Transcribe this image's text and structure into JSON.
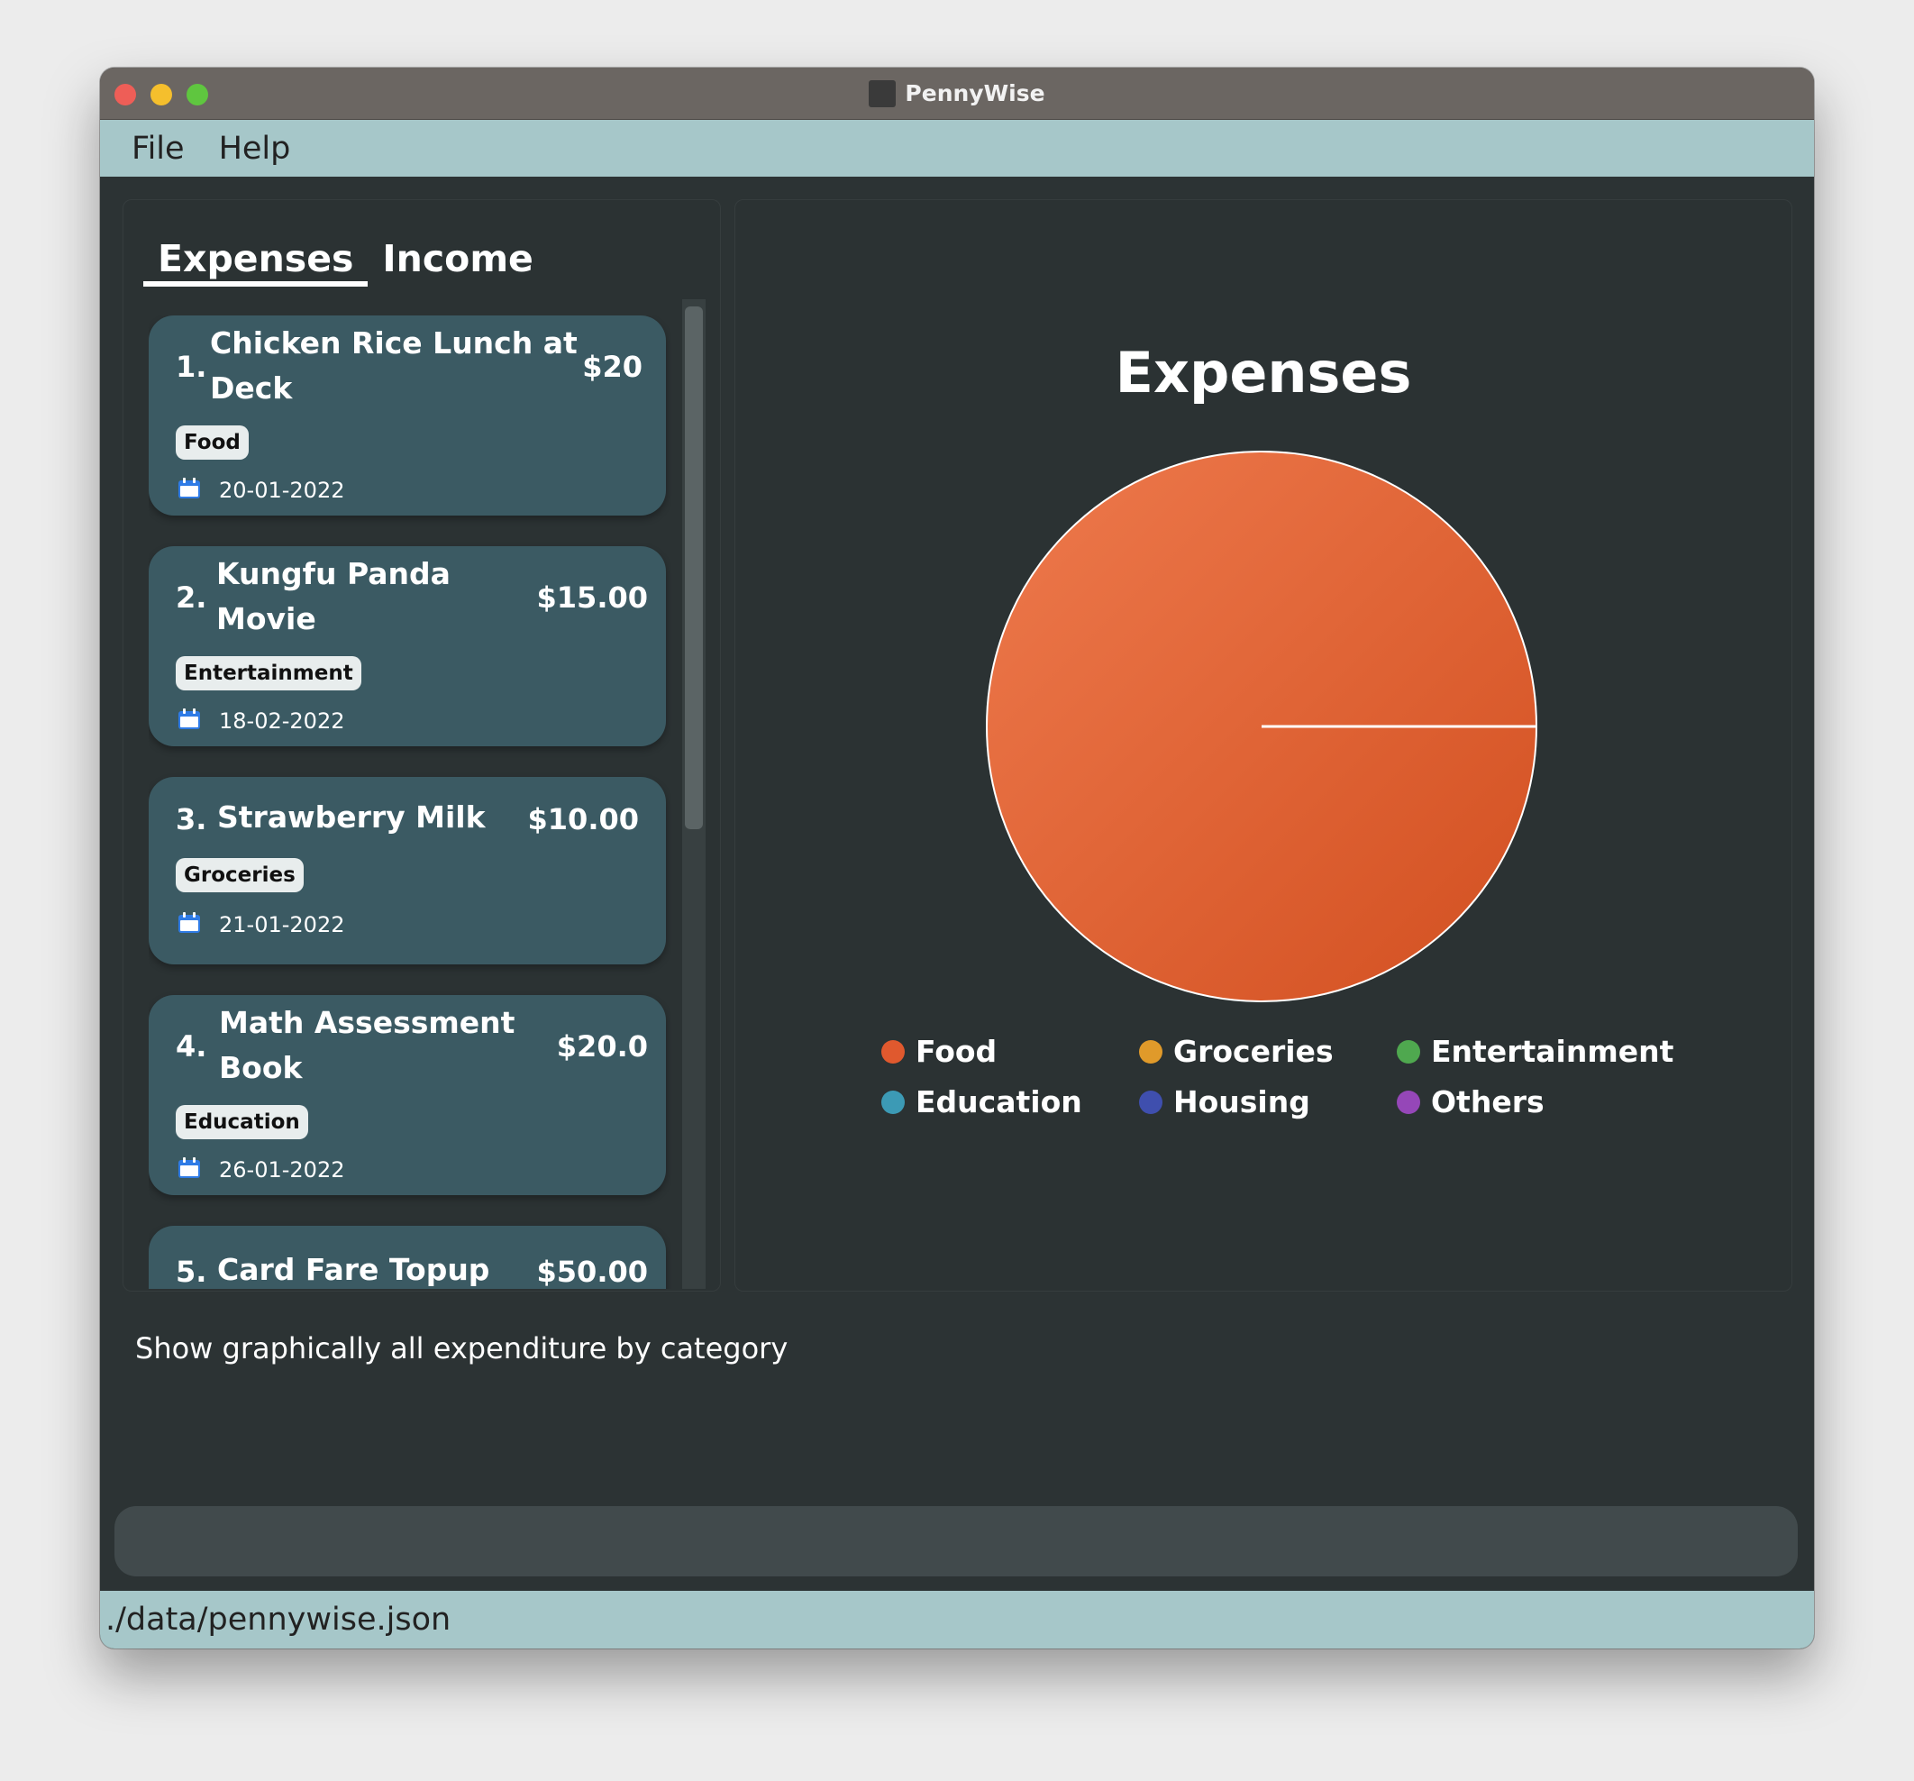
{
  "window": {
    "title": "PennyWise"
  },
  "menu": {
    "file": "File",
    "help": "Help"
  },
  "tabs": {
    "expenses": "Expenses",
    "income": "Income"
  },
  "entries": [
    {
      "index": "1.",
      "description_lines": [
        "Chicken Rice Lunch at",
        "Deck"
      ],
      "amount": "$20",
      "category": "Food",
      "date": "20-01-2022"
    },
    {
      "index": "2.",
      "description_lines": [
        "Kungfu Panda",
        "Movie"
      ],
      "amount": "$15.00",
      "category": "Entertainment",
      "date": "18-02-2022"
    },
    {
      "index": "3.",
      "description_lines": [
        "Strawberry Milk"
      ],
      "amount": "$10.00",
      "category": "Groceries",
      "date": "21-01-2022"
    },
    {
      "index": "4.",
      "description_lines": [
        "Math Assessment",
        "Book"
      ],
      "amount": "$20.0",
      "category": "Education",
      "date": "26-01-2022"
    },
    {
      "index": "5.",
      "description_lines": [
        "Card Fare Topup"
      ],
      "amount": "$50.00"
    }
  ],
  "chart_data": {
    "type": "pie",
    "title": "Expenses",
    "slices": [
      {
        "label": "Food",
        "value": 100,
        "color": "#e0592e"
      },
      {
        "label": "Groceries",
        "value": 0,
        "color": "#e09a2a"
      },
      {
        "label": "Entertainment",
        "value": 0,
        "color": "#4fa84f"
      },
      {
        "label": "Education",
        "value": 0,
        "color": "#3c9ab5"
      },
      {
        "label": "Housing",
        "value": 0,
        "color": "#3f4fae"
      },
      {
        "label": "Others",
        "value": 0,
        "color": "#9547b8"
      }
    ],
    "legend_position": "bottom"
  },
  "result_message": "Show graphically all expenditure by category",
  "command_input": {
    "value": ""
  },
  "status_bar": {
    "path": "./data/pennywise.json"
  },
  "colors": {
    "accent": "#a6c7c9",
    "background": "#2c3334",
    "card": "#3b5a63"
  }
}
